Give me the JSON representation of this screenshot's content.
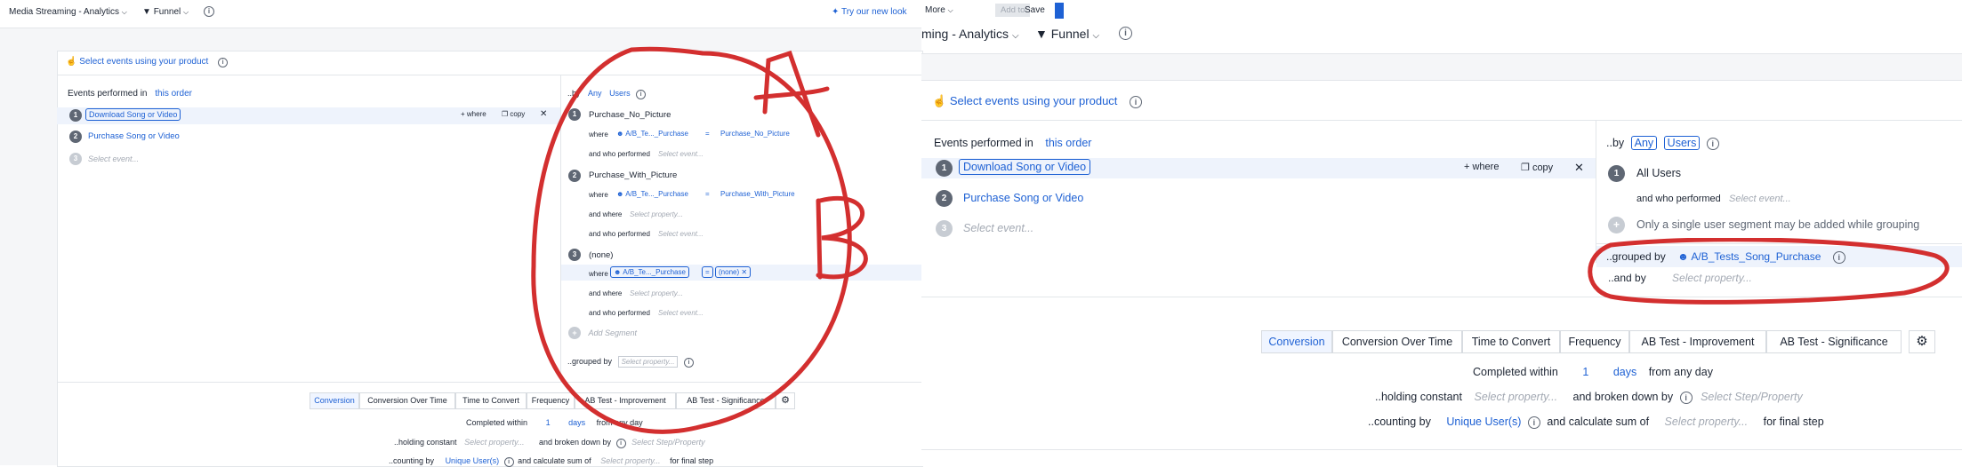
{
  "left": {
    "topbar": {
      "project": "Media Streaming - Analytics",
      "chart_type": "Funnel",
      "try_new_look": "Try our new look",
      "more": "More",
      "add_to": "Add to",
      "save": "Save"
    },
    "section_title": "Select events using your product",
    "events_label": "Events performed in",
    "order": "this order",
    "events": [
      {
        "num": "1",
        "label": "Download Song or Video"
      },
      {
        "num": "2",
        "label": "Purchase Song or Video"
      },
      {
        "num": "3",
        "label": "Select event..."
      }
    ],
    "where": "+ where",
    "copy": "copy",
    "by_prefix": "..by",
    "any": "Any",
    "users": "Users",
    "segments": [
      {
        "num": "1",
        "name": "Purchase_No_Picture",
        "where": "where",
        "property": "A/B_Te..._Purchase",
        "op": "=",
        "value": "Purchase_No_Picture",
        "and_who": "and who performed",
        "select_event": "Select event..."
      },
      {
        "num": "2",
        "name": "Purchase_With_Picture",
        "where": "where",
        "property": "A/B_Te..._Purchase",
        "op": "=",
        "value": "Purchase_With_Picture",
        "and_where": "and where",
        "select_property": "Select property...",
        "and_who": "and who performed",
        "select_event": "Select event..."
      },
      {
        "num": "3",
        "name": "(none)",
        "where": "where",
        "property": "A/B_Te..._Purchase",
        "op": "=",
        "value": "(none)",
        "and_where": "and where",
        "select_property": "Select property...",
        "and_who": "and who performed",
        "select_event": "Select event..."
      }
    ],
    "add_segment": "Add Segment",
    "grouped_by": "..grouped by",
    "grouped_placeholder": "Select property...",
    "tabs": [
      "Conversion",
      "Conversion Over Time",
      "Time to Convert",
      "Frequency",
      "AB Test - Improvement",
      "AB Test - Significance"
    ],
    "completed_within": "Completed within",
    "days_value": "1",
    "days": "days",
    "from_any_day": "from any day",
    "holding_constant": "..holding constant",
    "select_property": "Select property...",
    "broken_down_by": "and broken down by",
    "select_step": "Select Step/Property",
    "counting_by": "..counting by",
    "unique_users": "Unique User(s)",
    "calc_sum": "and calculate sum of",
    "for_final": "for final step",
    "annotation_a": "A",
    "annotation_b": "B",
    "annotation_color": "#d32f2f"
  },
  "right": {
    "project": "ming - Analytics",
    "chart_type": "Funnel",
    "section_title": "Select events using your product",
    "events_label": "Events performed in",
    "order": "this order",
    "events": [
      {
        "num": "1",
        "label": "Download Song or Video"
      },
      {
        "num": "2",
        "label": "Purchase Song or Video"
      },
      {
        "num": "3",
        "label": "Select event..."
      }
    ],
    "where": "+ where",
    "copy": "copy",
    "by_prefix": "..by",
    "any": "Any",
    "users": "Users",
    "segment_num": "1",
    "segment_name": "All Users",
    "and_who": "and who performed",
    "select_event": "Select event...",
    "single_segment_note": "Only a single user segment may be added while grouping",
    "grouped_by": "..grouped by",
    "grouped_value": "A/B_Tests_Song_Purchase",
    "and_by": "..and by",
    "and_by_placeholder": "Select property...",
    "tabs": [
      "Conversion",
      "Conversion Over Time",
      "Time to Convert",
      "Frequency",
      "AB Test - Improvement",
      "AB Test - Significance"
    ],
    "completed_within": "Completed within",
    "days_value": "1",
    "days": "days",
    "from_any_day": "from any day",
    "holding_constant": "..holding constant",
    "select_property": "Select property...",
    "broken_down_by": "and broken down by",
    "select_step": "Select Step/Property",
    "counting_by": "..counting by",
    "unique_users": "Unique User(s)",
    "calc_sum": "and calculate sum of",
    "for_final": "for final step"
  }
}
